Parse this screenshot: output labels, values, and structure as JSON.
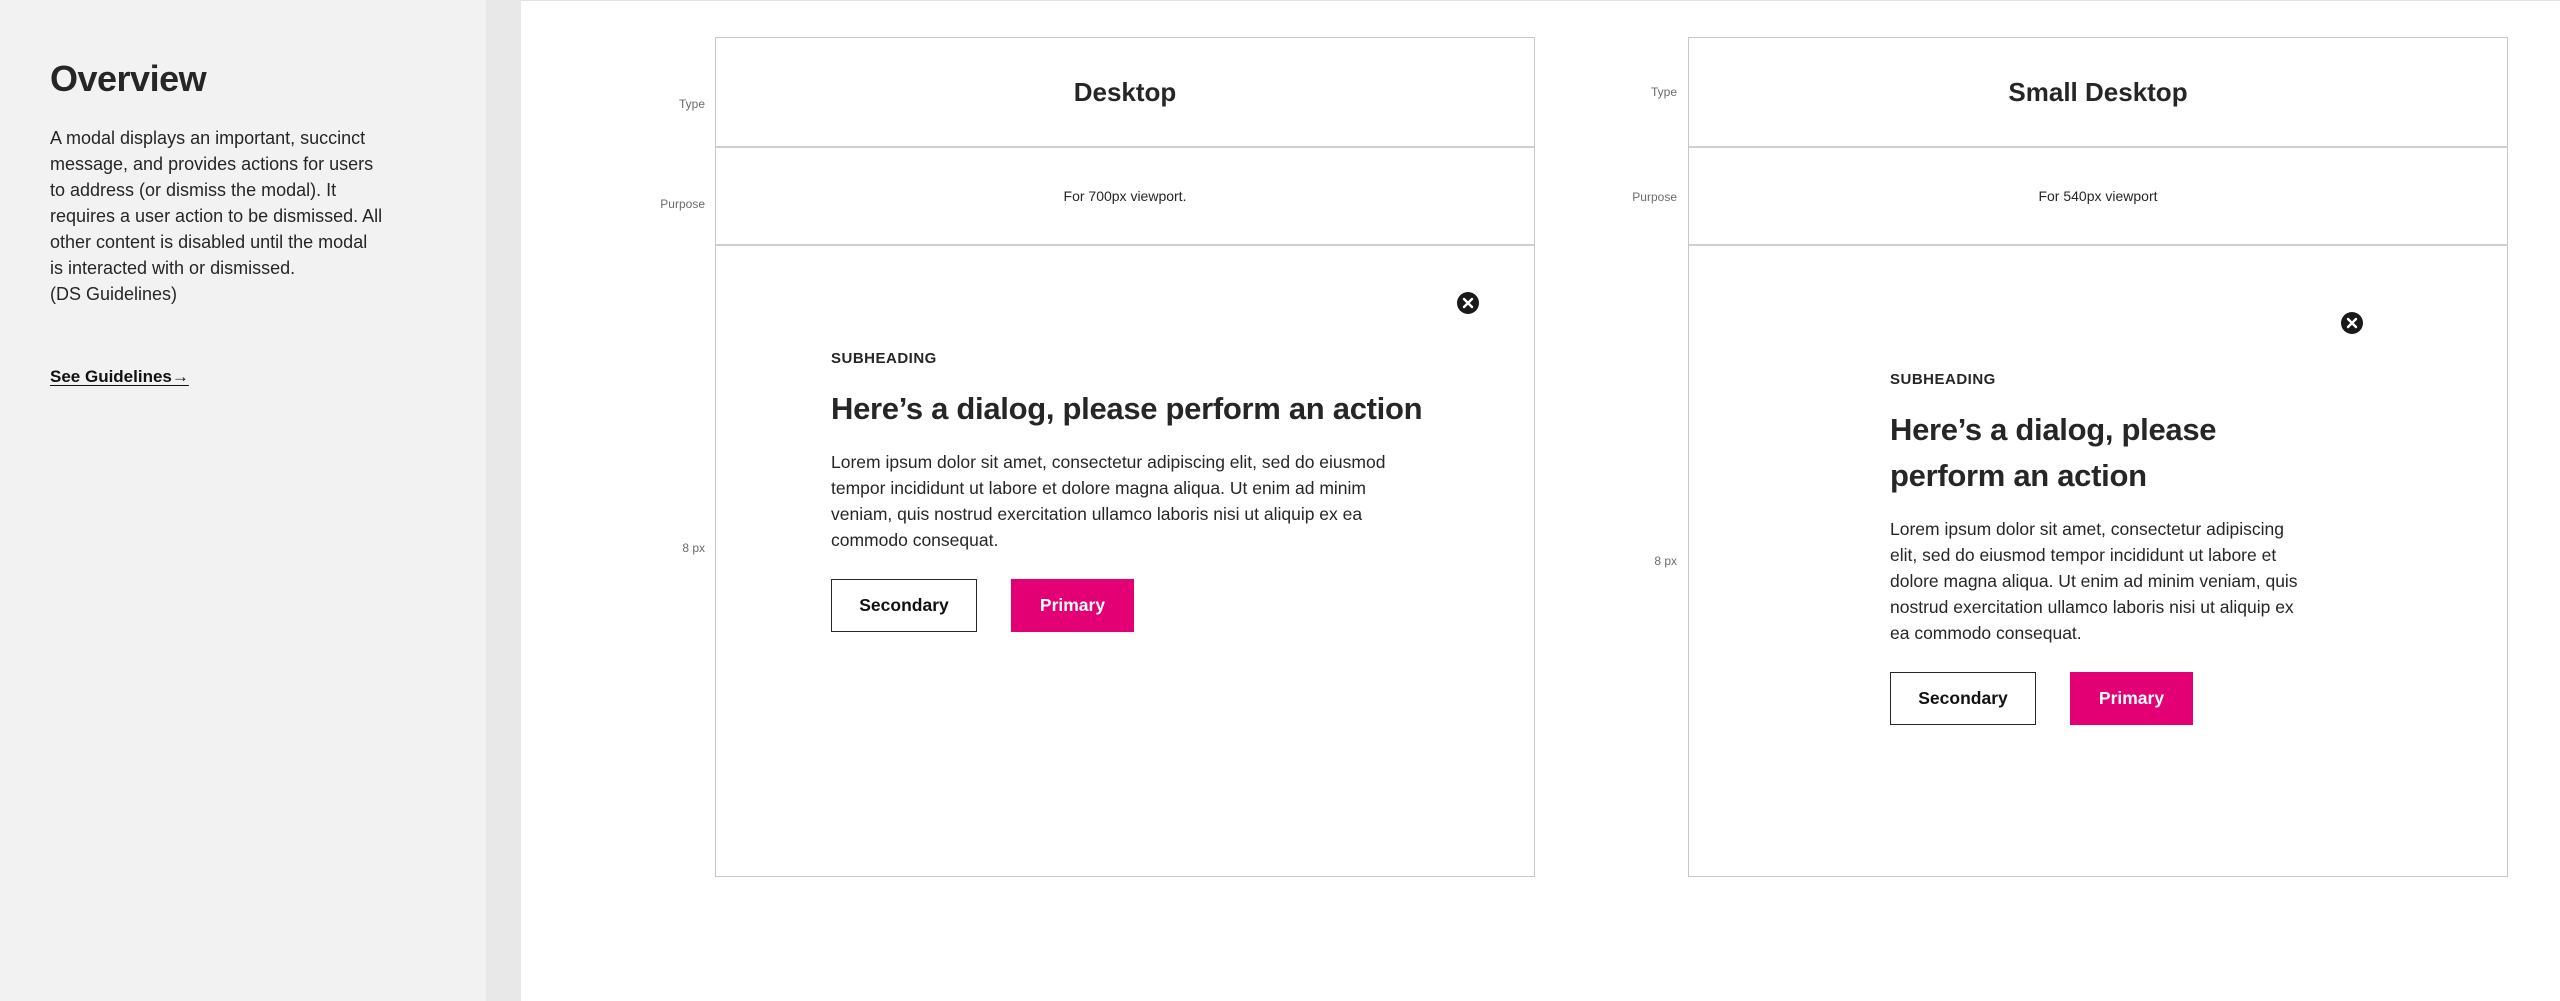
{
  "sidebar": {
    "title": "Overview",
    "description": "A modal displays an important, succinct\nmessage, and provides actions for users\nto address (or dismiss the modal). It\nrequires a user action to be dismissed. All\nother content is disabled until the modal\nis interacted with or dismissed.\n(DS Guidelines)",
    "link_label": "See Guidelines→"
  },
  "row_labels": {
    "type": "Type",
    "purpose": "Purpose",
    "spacing": "8 px"
  },
  "variants": [
    {
      "type": "Desktop",
      "purpose": "For 700px viewport."
    },
    {
      "type": "Small Desktop",
      "purpose": "For 540px viewport"
    }
  ],
  "dialog": {
    "subheading": "SUBHEADING",
    "heading": "Here’s a dialog, please perform an action",
    "body": "Lorem ipsum dolor sit amet, consectetur adipiscing elit, sed do eiusmod tempor incididunt ut labore et dolore magna aliqua. Ut enim ad minim veniam, quis nostrud exercitation ullamco laboris nisi ut aliquip ex ea commodo consequat.",
    "secondary_label": "Secondary",
    "primary_label": "Primary",
    "close_icon": "close-circle-icon"
  },
  "colors": {
    "primary": "#e20074",
    "text": "#262626",
    "sidebar_bg": "#f2f2f2"
  }
}
